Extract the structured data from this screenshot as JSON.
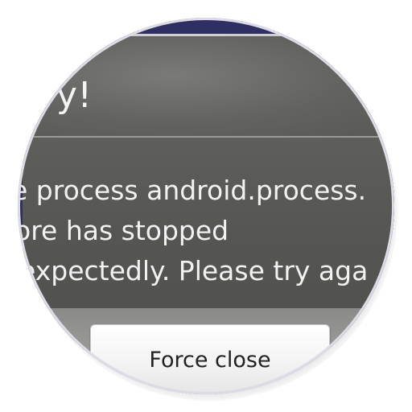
{
  "dialog": {
    "title": "orry!",
    "message_lines": [
      "e process android.process.",
      "ore has stopped",
      "expectedly. Please try aga"
    ],
    "force_close_label": "Force close"
  },
  "colors": {
    "ring": "#2e2f63",
    "dialog_bg": "#5e5e5b",
    "button_bg": "#f3f3f3",
    "text": "#f2f2f2"
  }
}
